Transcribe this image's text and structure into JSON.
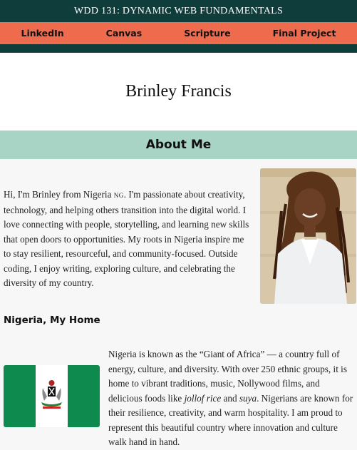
{
  "header": {
    "course_title": "WDD 131: DYNAMIC WEB FUNDAMENTALS"
  },
  "nav": {
    "items": [
      "LinkedIn",
      "Canvas",
      "Scripture",
      "Final Project"
    ]
  },
  "hero": {
    "name": "Brinley Francis"
  },
  "about": {
    "heading": "About Me",
    "text_before_flag": "Hi, I'm Brinley from Nigeria ",
    "country_code": "NG",
    "text_after_flag": ". I'm passionate about creativity, technology, and helping others transition into the digital world. I love connecting with people, storytelling, and learning new skills that open doors to opportunities. My roots in Nigeria inspire me to stay resilient, resourceful, and community-focused. Outside coding, I enjoy writing, exploring culture, and celebrating the diversity of my country."
  },
  "home": {
    "heading": "Nigeria, My Home",
    "text_1": "Nigeria is known as the “Giant of Africa” — a country full of energy, culture, and diversity. With over 250 ethnic groups, it is home to vibrant traditions, music, Nollywood films, and delicious foods like ",
    "food_1": "jollof rice",
    "text_2": " and ",
    "food_2": "suya",
    "text_3": ". Nigerians are known for their resilience, creativity, and warm hospitality. I am proud to represent this beautiful country where innovation and culture walk hand in hand."
  },
  "colors": {
    "header_bg": "#0e3d3c",
    "nav_bg": "#ee6c4d",
    "section_bar_bg": "#a8d4c5",
    "flag_green": "#0e8a4f"
  }
}
